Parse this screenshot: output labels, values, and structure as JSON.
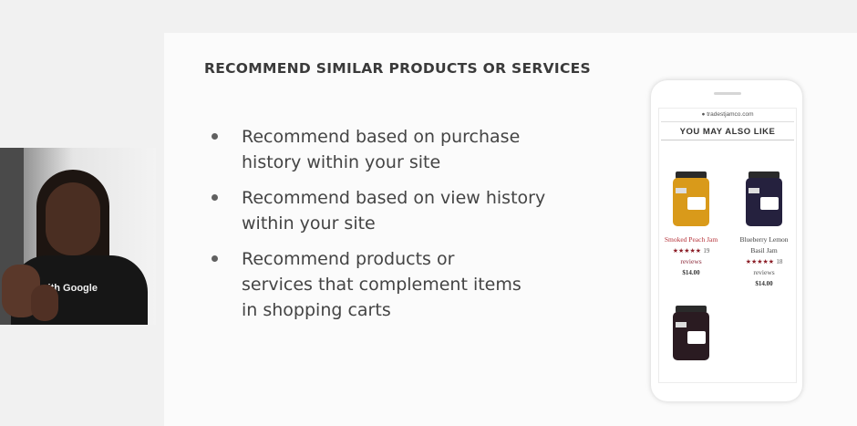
{
  "slide": {
    "title": "RECOMMEND SIMILAR PRODUCTS OR SERVICES",
    "bullets": [
      "Recommend based on purchase\nhistory within your site",
      "Recommend based on view history\nwithin your site",
      "Recommend products or\nservices that complement items\nin shopping carts"
    ]
  },
  "video": {
    "shirt_text": "with Google"
  },
  "phone": {
    "url": "● tradestjamco.com",
    "heading": "YOU MAY ALSO LIKE",
    "products": [
      {
        "name": "Smoked Peach Jam",
        "stars": "★★★★★",
        "review_count": "19",
        "reviews_label": "reviews",
        "price": "$14.00",
        "jar_color": "#d99a1a",
        "name_color": "#b5333a"
      },
      {
        "name": "Blueberry Lemon Basil Jam",
        "name_line1": "Blueberry Lemon",
        "name_line2": "Basil Jam",
        "stars": "★★★★★",
        "review_count": "18",
        "reviews_label": "reviews",
        "price": "$14.00",
        "jar_color": "#25213e",
        "name_color": "#444444"
      },
      {
        "name": "",
        "jar_color": "#2a1b21"
      }
    ]
  },
  "colors": {
    "star": "#8b1d26",
    "review_link": "#8b2a3a"
  }
}
